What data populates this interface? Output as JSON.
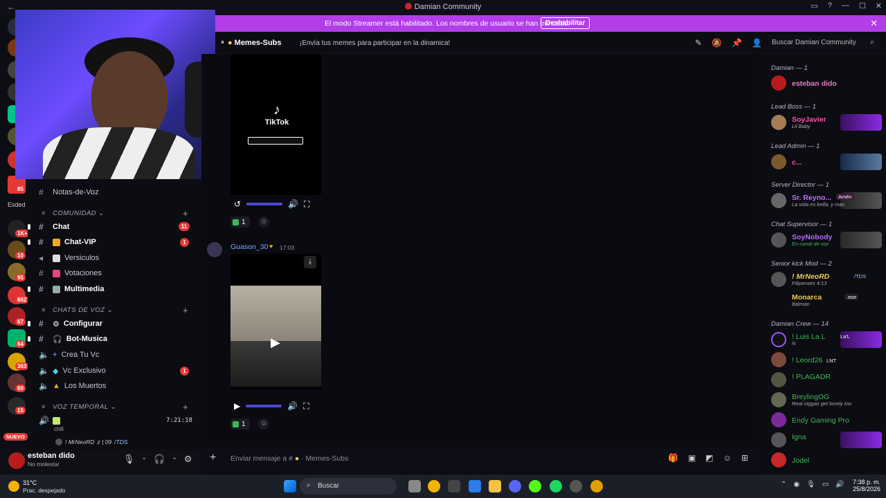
{
  "window": {
    "title": "Damian Community",
    "back": "←",
    "minimize": "—",
    "maximize": "☐",
    "close": "✕"
  },
  "banner": {
    "message": "El modo Streamer está habilitado. Los nombres de usuario se han truncado.",
    "button": "Deshabilitar",
    "close": "✕"
  },
  "guilds": {
    "badges": [
      "85",
      "1K+",
      "10",
      "95",
      "662",
      "67",
      "64",
      "363",
      "60",
      "15"
    ],
    "esded_label": "Esded",
    "nuevo_label": "NUEVO"
  },
  "sidebar": {
    "channels_top": [
      {
        "label": "Notas-de-Voz"
      }
    ],
    "category_comunidad": "COMUNIDAD",
    "comunidad_channels": [
      {
        "label": "Chat",
        "badge": "11"
      },
      {
        "label": "Chat-VIP",
        "badge": "1"
      },
      {
        "label": "Versiculos"
      },
      {
        "label": "Votaciones"
      },
      {
        "label": "Multimedia"
      }
    ],
    "category_voz": "CHATS DE VOZ",
    "voz_channels": [
      {
        "label": "Configurar"
      },
      {
        "label": "Bot-Musica"
      },
      {
        "label": "Crea Tu Vc"
      },
      {
        "label": "Vc Exclusivo",
        "badge": "1"
      },
      {
        "label": "Los Muertos"
      }
    ],
    "category_temporal": "VOZ TEMPORAL",
    "temporal": {
      "label": "chill",
      "time": "7:21:18",
      "user": "! MrNeoRD",
      "user_suffix": "z | 09",
      "user_tag": "/TDS"
    }
  },
  "user_panel": {
    "name": "esteban dido",
    "status": "No molestar"
  },
  "channel_header": {
    "name": "Memes-Subs",
    "topic": "¡Envía tus memes para participar en la dinamica!",
    "search_placeholder": "Buscar Damian Community"
  },
  "messages": {
    "tiktok_text": "TikTok",
    "reaction_count_1": "1",
    "author": "Guason_30",
    "time": "17:03",
    "reaction_count_2": "1"
  },
  "composer": {
    "placeholder": "Enviar mensaje a #",
    "channel": "Memes-Subs"
  },
  "members": {
    "roles": [
      {
        "label": "Damian — 1"
      },
      {
        "label": "Lead Boss — 1"
      },
      {
        "label": "Lead Admin — 1"
      },
      {
        "label": "Server Director — 1"
      },
      {
        "label": "Chat Supervisor — 1"
      },
      {
        "label": "Senior kick Mod — 2"
      },
      {
        "label": "Damian Crew — 14"
      }
    ],
    "list": [
      {
        "name": "esteban dido",
        "sub": "",
        "color": "#e57fbf"
      },
      {
        "name": "SoyJavier",
        "sub": "Lil Baby",
        "color": "#ff4fa8"
      },
      {
        "name": "c...",
        "sub": "",
        "color": "#ff4fa8"
      },
      {
        "name": "Sr. Reyno...",
        "sub": "La vida es bella, y mas",
        "color": "#c070ff"
      },
      {
        "name": "SoyNobody",
        "sub": "En canal de voz",
        "color": "#b56cff"
      },
      {
        "name": "! MrNeoRD",
        "sub": "Filipenses 4:13",
        "color": "#f2c94c"
      },
      {
        "name": "Monarca",
        "sub": "Batman",
        "color": "#f2c94c"
      },
      {
        "name": "! Luis La L",
        "sub": "N",
        "color": "#3fb950"
      },
      {
        "name": "! Leord26",
        "sub": "",
        "color": "#3fb950"
      },
      {
        "name": "! PLAGADR",
        "sub": "",
        "color": "#3fb950"
      },
      {
        "name": "BreylingOG",
        "sub": "Real niggas get lonely too",
        "color": "#3fb950"
      },
      {
        "name": "Endy Gaming Pro",
        "sub": "",
        "color": "#3fb950"
      },
      {
        "name": "Igna",
        "sub": "",
        "color": "#3fb950"
      },
      {
        "name": "Jodel",
        "sub": "",
        "color": "#3fb950"
      }
    ],
    "tag_tds": "/TDS",
    "tag_lnt": "LNT",
    "tag_amen": "Amén",
    "tag_exe": ".exe",
    "tag_lal": "La'L"
  },
  "taskbar": {
    "temp": "31°C",
    "weather": "Prac. despejado",
    "search": "Buscar",
    "time": "7:38 p. m.",
    "date": "25/8/2026"
  }
}
